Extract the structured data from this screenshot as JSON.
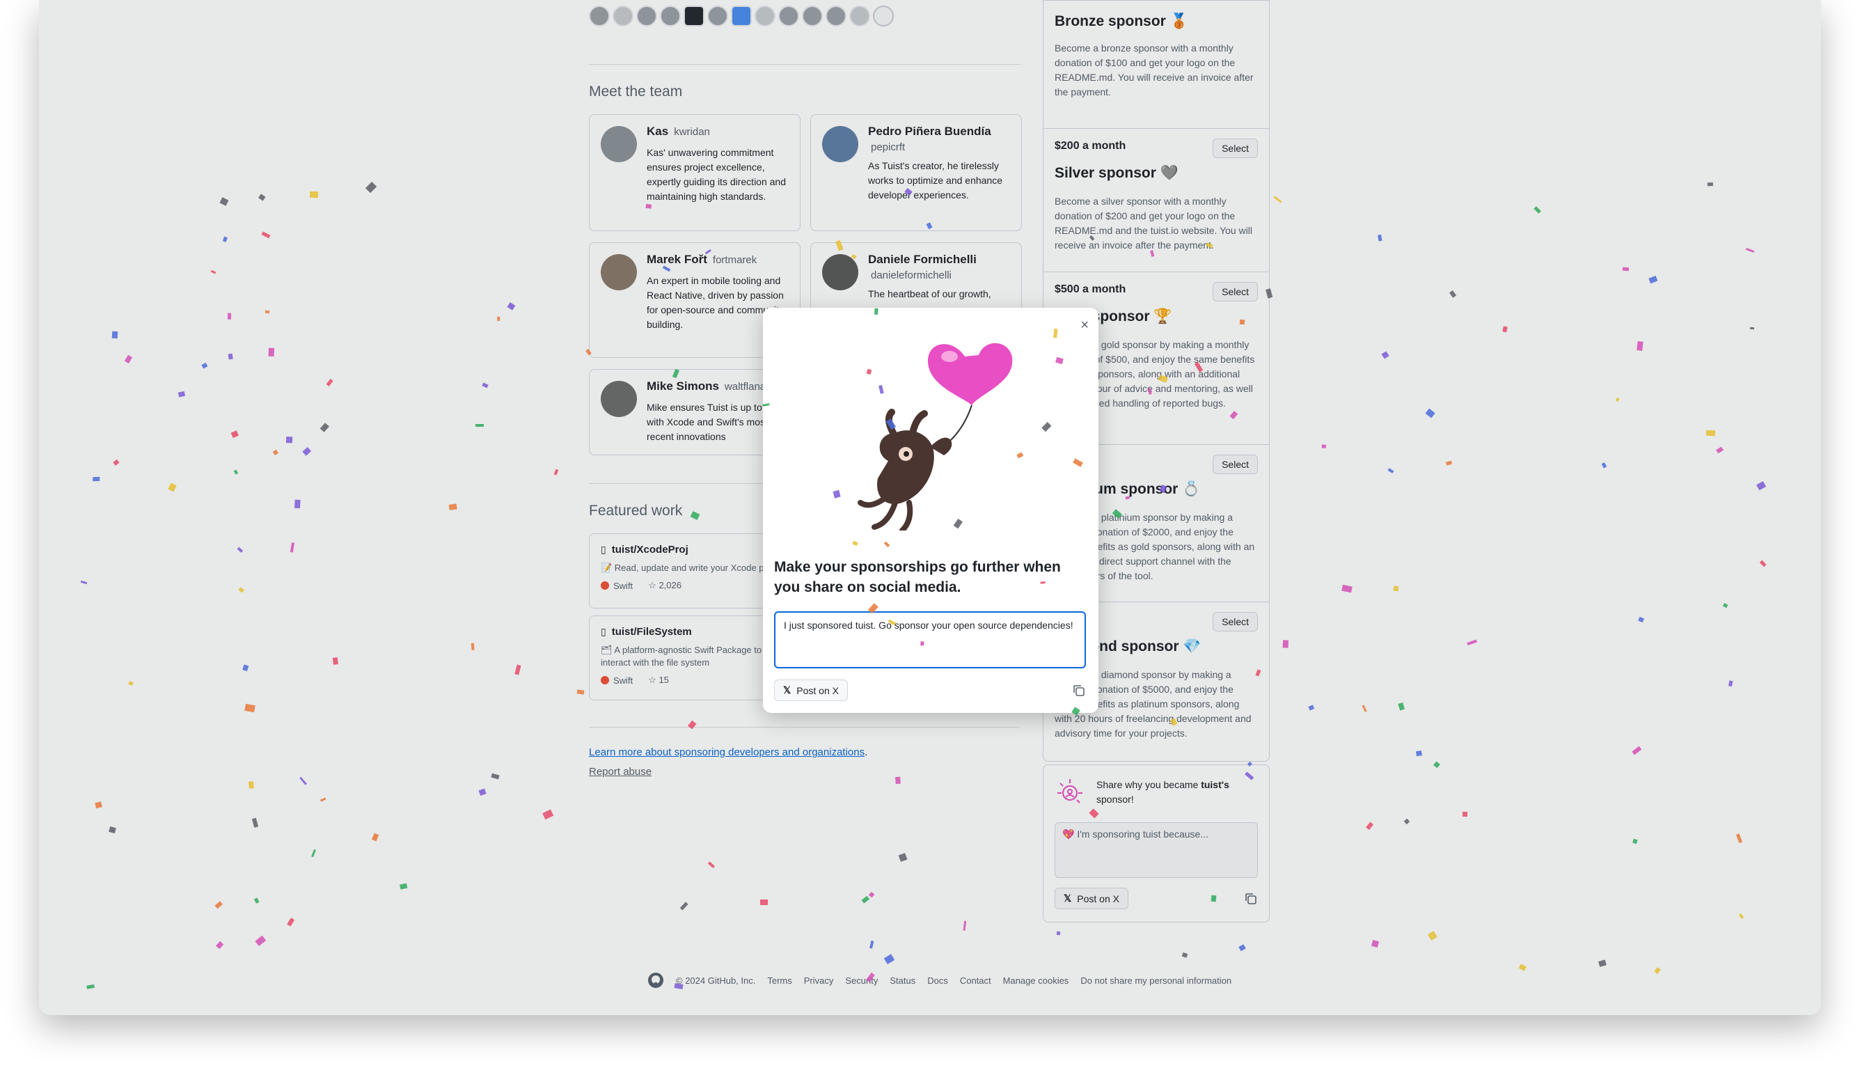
{
  "team": {
    "heading": "Meet the team",
    "members": [
      {
        "name": "Kas",
        "handle": "kwridan",
        "bio": "Kas' unwavering commitment ensures project excellence, expertly guiding its direction and maintaining high standards."
      },
      {
        "name": "Pedro Piñera Buendía",
        "handle": "pepicrft",
        "bio": "As Tuist's creator, he tirelessly works to optimize and enhance developer experiences."
      },
      {
        "name": "Marek Fořt",
        "handle": "fortmarek",
        "bio": "An expert in mobile tooling and React Native, driven by passion for open-source and community building."
      },
      {
        "name": "Daniele Formichelli",
        "handle": "danieleformichelli",
        "bio": "The heartbeat of our growth,"
      },
      {
        "name": "Mike Simons",
        "handle": "waltflanag",
        "bio": "Mike ensures Tuist is up to date with Xcode and Swift's most recent innovations"
      }
    ]
  },
  "featured": {
    "heading": "Featured work",
    "repos": [
      {
        "name": "tuist/XcodeProj",
        "description": "📝 Read, update and write your Xcode pr",
        "language": "Swift",
        "stars": "2,026"
      },
      {
        "name": "tuist/FileSystem",
        "description": "🗂 A platform-agnostic Swift Package to interact with the file system",
        "language": "Swift",
        "stars": "15"
      }
    ]
  },
  "links": {
    "learn_more": "Learn more about sponsoring developers and organizations",
    "learn_more_suffix": ".",
    "report_abuse": "Report abuse"
  },
  "tiers": [
    {
      "price": "",
      "name": "Bronze sponsor 🥉",
      "description": "Become a bronze sponsor with a monthly donation of $100 and get your logo on the README.md. You will receive an invoice after the payment.",
      "select_label": ""
    },
    {
      "price": "$200 a month",
      "name": "Silver sponsor 🩶",
      "description": "Become a silver sponsor with a monthly donation of $200 and get your logo on the README.md and the tuist.io website. You will receive an invoice after the payment.",
      "select_label": "Select"
    },
    {
      "price": "$500 a month",
      "name": "Gold sponsor 🏆",
      "description": "Become a gold sponsor by making a monthly donation of $500, and enjoy the same benefits as silver sponsors, along with an additional monthly hour of advice and mentoring, as well as prioritized handling of reported bugs.",
      "select_label": "Select"
    },
    {
      "price": "a month",
      "name": "Platinum sponsor 💍",
      "description": "Become a platinium sponsor by making a monthly donation of $2000, and enjoy the same benefits as gold sponsors, along with an additional direct support channel with the maintainers of the tool.",
      "select_label": "Select"
    },
    {
      "price": "a month",
      "name": "Diamond sponsor 💎",
      "description": "Become a diamond sponsor by making a monthly donation of $5000, and enjoy the same benefits as platinum sponsors, along with 20 hours of freelancing development and advisory time for your projects.",
      "select_label": "Select"
    }
  ],
  "share_box": {
    "text_prefix": "Share why you became ",
    "org": "tuist's",
    "text_suffix": " sponsor!",
    "placeholder": "💖 I'm sponsoring tuist because...",
    "post_label": "Post on X"
  },
  "modal": {
    "title": "Make your sponsorships go further when you share on social media.",
    "message": "I just sponsored tuist. Go sponsor your open source dependencies!",
    "post_label": "Post on X",
    "close_glyph": "×"
  },
  "footer": {
    "copyright": "© 2024 GitHub, Inc.",
    "links": [
      "Terms",
      "Privacy",
      "Security",
      "Status",
      "Docs",
      "Contact",
      "Manage cookies",
      "Do not share my personal information"
    ]
  },
  "colors": {
    "accent": "#0969da",
    "swift": "#f05138",
    "heart": "#e84fc4",
    "overlay": "rgba(31,35,40,0.10)"
  }
}
